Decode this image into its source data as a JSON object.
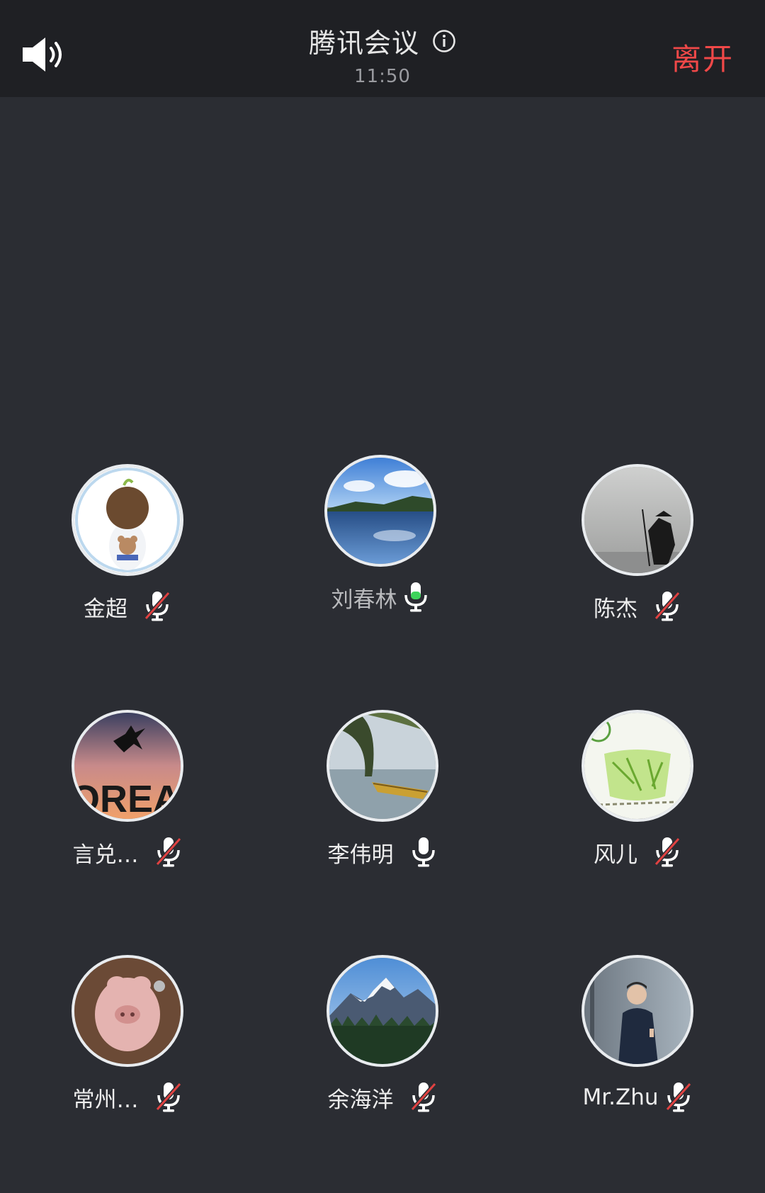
{
  "header": {
    "title": "腾讯会议",
    "time": "11:50",
    "leave_label": "离开",
    "icons": [
      "speaker-icon",
      "info-icon"
    ]
  },
  "colors": {
    "background": "#2b2d33",
    "topbar": "#1f2024",
    "leave": "#f04848",
    "mic_active": "#3dd35a",
    "mic_muted_slash": "#e04141"
  },
  "participants": [
    {
      "name": "金超",
      "mic": "muted",
      "avatar": "cartoon-boy"
    },
    {
      "name": "刘春林",
      "mic": "speaking",
      "avatar": "lake"
    },
    {
      "name": "陈杰",
      "mic": "muted",
      "avatar": "fisherman"
    },
    {
      "name": "言兑…",
      "mic": "muted",
      "avatar": "dream-jump"
    },
    {
      "name": "李伟明",
      "mic": "on",
      "avatar": "boat"
    },
    {
      "name": "风儿",
      "mic": "muted",
      "avatar": "green-tea"
    },
    {
      "name": "常州…",
      "mic": "muted",
      "avatar": "pig-toy"
    },
    {
      "name": "余海洋",
      "mic": "muted",
      "avatar": "mountain"
    },
    {
      "name": "Mr.Zhu",
      "mic": "muted",
      "avatar": "speaker-man"
    }
  ]
}
